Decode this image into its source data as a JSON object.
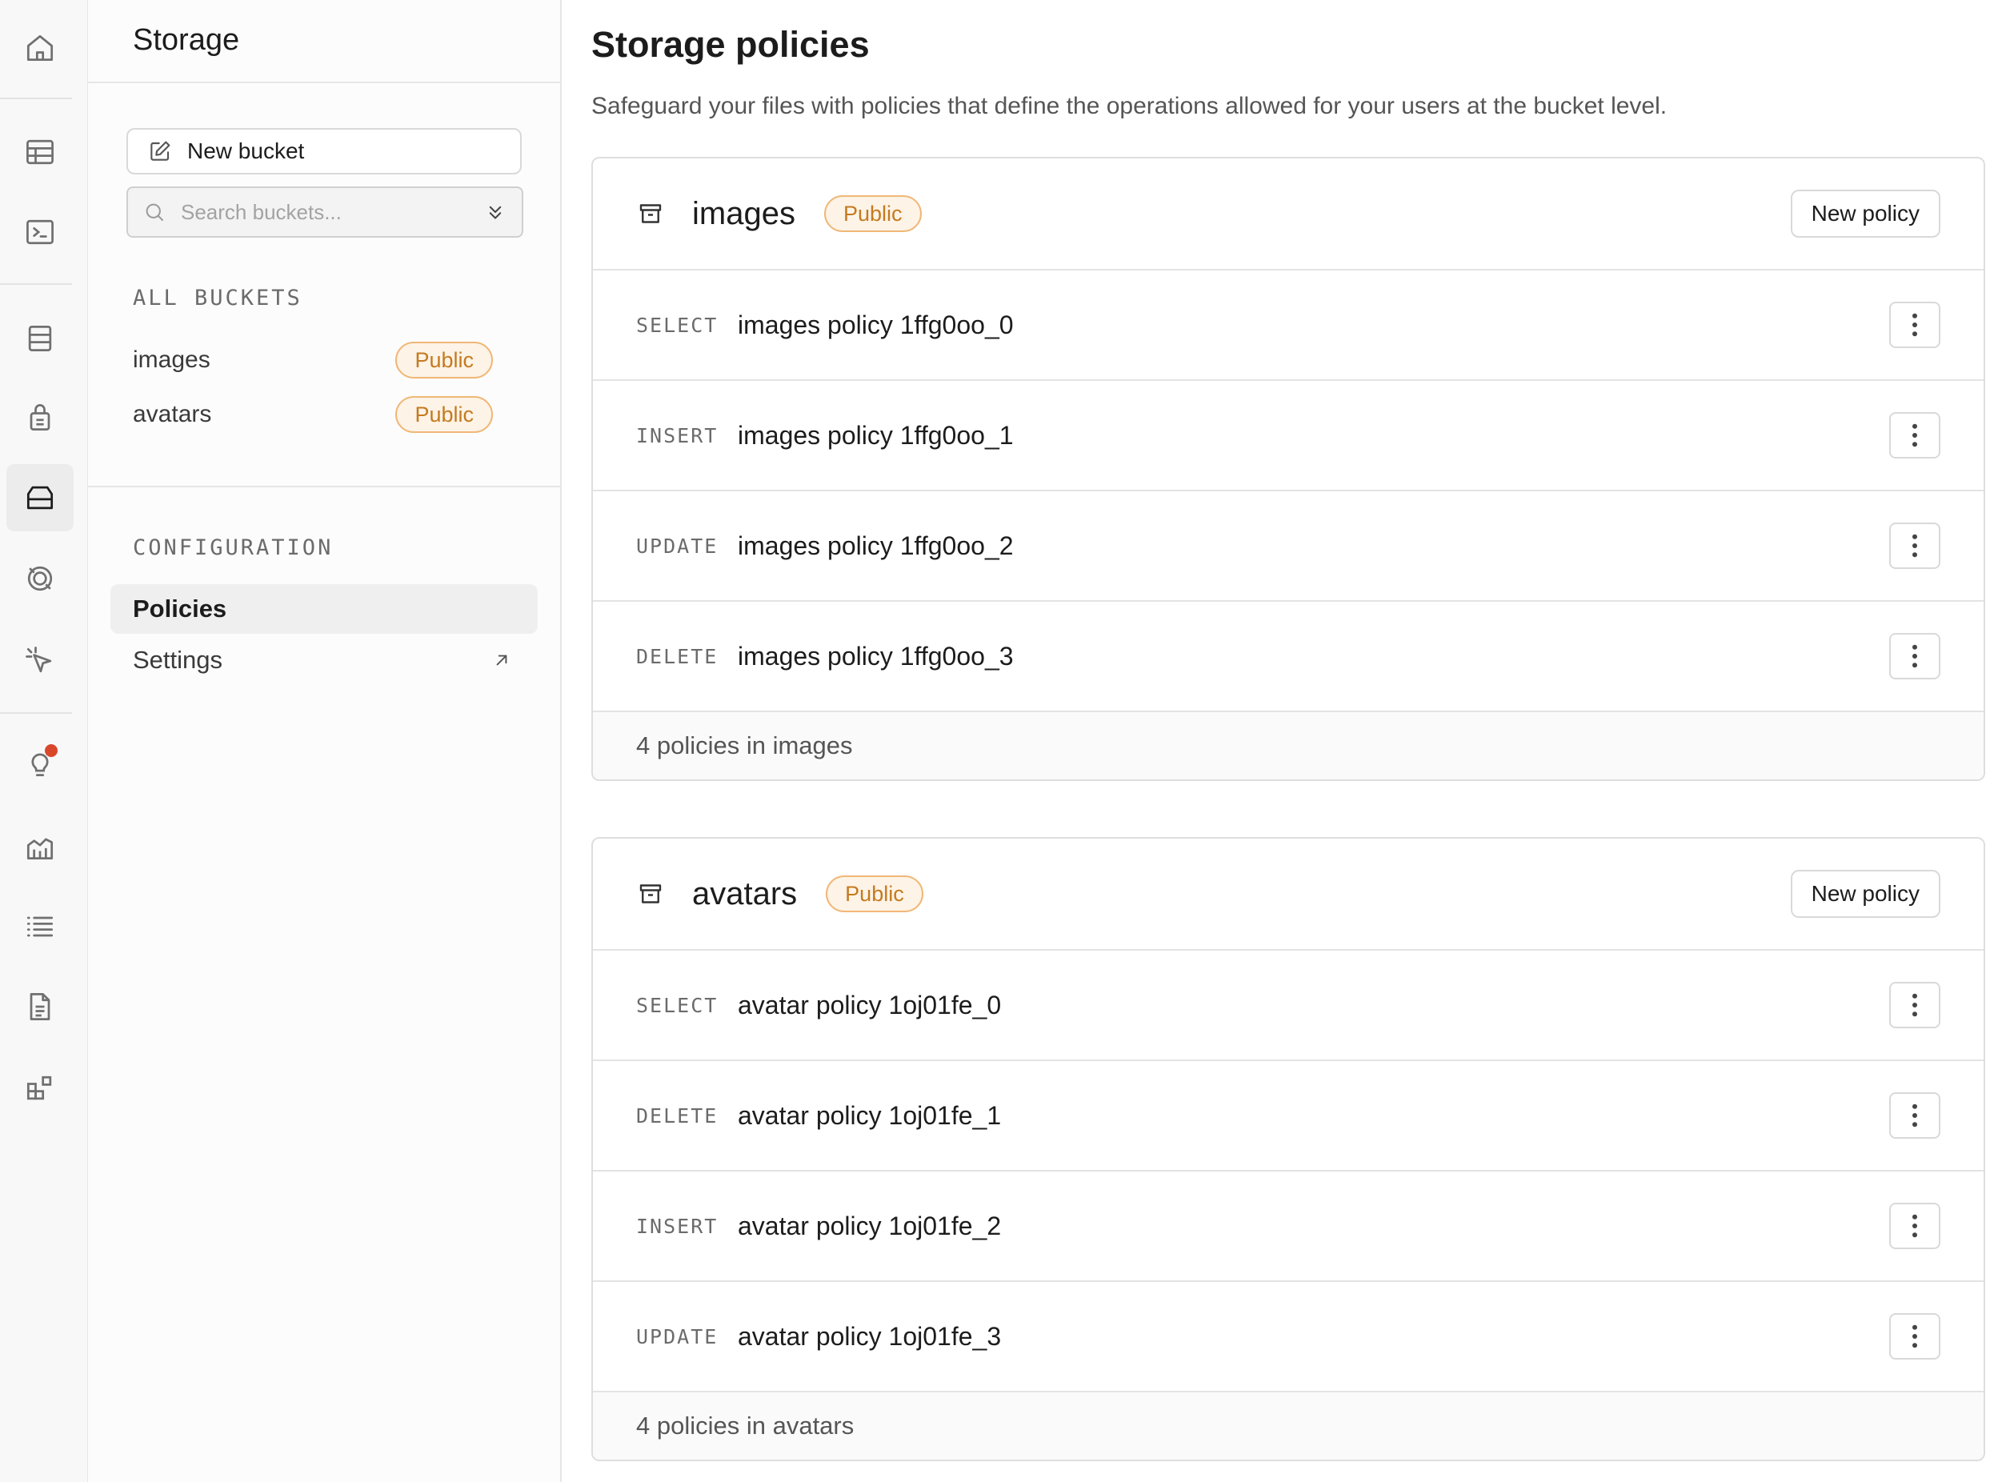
{
  "rail": {
    "items": [
      {
        "icon": "home-icon"
      },
      {
        "icon": "table-editor-icon"
      },
      {
        "icon": "sql-editor-icon"
      },
      {
        "icon": "database-icon"
      },
      {
        "icon": "authentication-icon"
      },
      {
        "icon": "storage-icon",
        "active": true
      },
      {
        "icon": "edge-functions-icon"
      },
      {
        "icon": "realtime-icon"
      },
      {
        "icon": "advisors-icon",
        "notification": true
      },
      {
        "icon": "reports-icon"
      },
      {
        "icon": "logs-icon"
      },
      {
        "icon": "api-docs-icon"
      },
      {
        "icon": "integrations-icon"
      }
    ]
  },
  "sidebar": {
    "title": "Storage",
    "new_bucket_label": "New bucket",
    "search_placeholder": "Search buckets...",
    "search_value": "",
    "all_buckets_label": "ALL BUCKETS",
    "buckets": [
      {
        "name": "images",
        "badge": "Public"
      },
      {
        "name": "avatars",
        "badge": "Public"
      }
    ],
    "configuration_label": "CONFIGURATION",
    "nav": [
      {
        "label": "Policies",
        "active": true
      },
      {
        "label": "Settings",
        "external": true
      }
    ]
  },
  "main": {
    "title": "Storage policies",
    "subtitle": "Safeguard your files with policies that define the operations allowed for your users at the bucket level.",
    "buckets": [
      {
        "name": "images",
        "badge": "Public",
        "new_policy_label": "New policy",
        "policies": [
          {
            "command": "SELECT",
            "name": "images policy 1ffg0oo_0"
          },
          {
            "command": "INSERT",
            "name": "images policy 1ffg0oo_1"
          },
          {
            "command": "UPDATE",
            "name": "images policy 1ffg0oo_2"
          },
          {
            "command": "DELETE",
            "name": "images policy 1ffg0oo_3"
          }
        ],
        "footer": "4 policies in images"
      },
      {
        "name": "avatars",
        "badge": "Public",
        "new_policy_label": "New policy",
        "policies": [
          {
            "command": "SELECT",
            "name": "avatar policy 1oj01fe_0"
          },
          {
            "command": "DELETE",
            "name": "avatar policy 1oj01fe_1"
          },
          {
            "command": "INSERT",
            "name": "avatar policy 1oj01fe_2"
          },
          {
            "command": "UPDATE",
            "name": "avatar policy 1oj01fe_3"
          }
        ],
        "footer": "4 policies in avatars"
      }
    ]
  },
  "colors": {
    "badge_text": "#c57a20",
    "badge_border": "#f0b777",
    "badge_bg": "#fdf3e6",
    "notification_dot": "#d9472b"
  }
}
